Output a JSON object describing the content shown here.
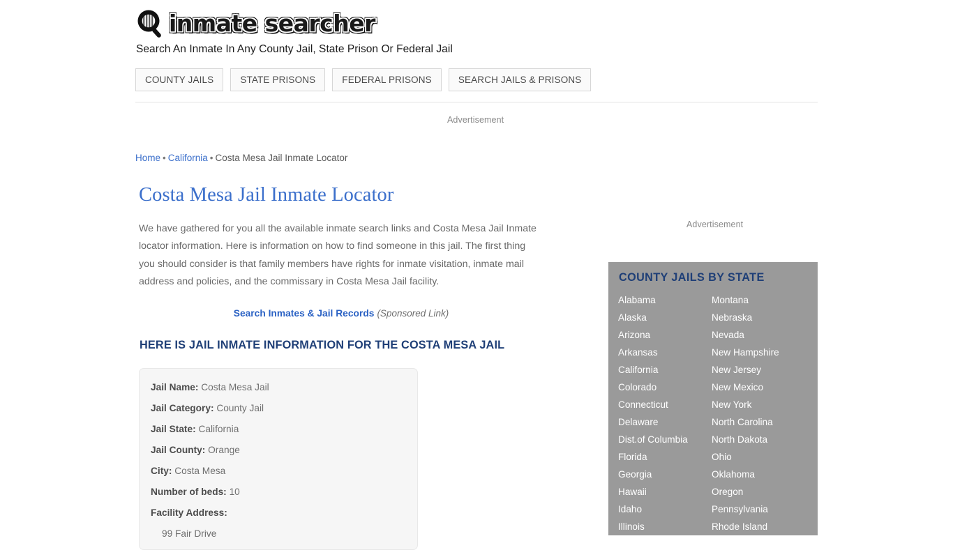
{
  "header": {
    "logo_icon": "magnifier-jail-bars-icon",
    "logo_text": "inmate searcher",
    "tagline": "Search An Inmate In Any County Jail, State Prison Or Federal Jail"
  },
  "nav": {
    "items": [
      {
        "label": "COUNTY JAILS"
      },
      {
        "label": "STATE PRISONS"
      },
      {
        "label": "FEDERAL PRISONS"
      },
      {
        "label": "SEARCH JAILS & PRISONS"
      }
    ]
  },
  "ads": {
    "top_label": "Advertisement",
    "side_label": "Advertisement"
  },
  "breadcrumb": {
    "home": "Home",
    "sep1": "•",
    "state": "California",
    "sep2": "•",
    "current": "Costa Mesa Jail Inmate Locator"
  },
  "main": {
    "title": "Costa Mesa Jail Inmate Locator",
    "intro": "We have gathered for you all the available inmate search links and Costa Mesa Jail Inmate locator information. Here is information on how to find someone in this jail. The first thing you should consider is that family members have rights for inmate visitation, inmate mail address and policies, and the commissary in Costa Mesa Jail facility.",
    "sponsored_link_text": "Search Inmates & Jail Records",
    "sponsored_note": "(Sponsored Link)",
    "section_heading": "HERE IS JAIL INMATE INFORMATION FOR THE COSTA MESA JAIL",
    "info": {
      "rows": [
        {
          "label": "Jail Name:",
          "value": "Costa Mesa Jail"
        },
        {
          "label": "Jail Category:",
          "value": "County Jail"
        },
        {
          "label": "Jail State:",
          "value": "California"
        },
        {
          "label": "Jail County:",
          "value": "Orange"
        },
        {
          "label": "City:",
          "value": "Costa Mesa"
        },
        {
          "label": "Number of beds:",
          "value": "10"
        }
      ],
      "address_label": "Facility Address:",
      "address_line1": "99 Fair Drive"
    }
  },
  "sidebar": {
    "title": "COUNTY JAILS BY STATE",
    "background_color": "#9a9a9a",
    "title_color": "#1f3f77",
    "link_color": "#ffffff",
    "column_left": [
      "Alabama",
      "Alaska",
      "Arizona",
      "Arkansas",
      "California",
      "Colorado",
      "Connecticut",
      "Delaware",
      "Dist.of Columbia",
      "Florida",
      "Georgia",
      "Hawaii",
      "Idaho",
      "Illinois"
    ],
    "column_right": [
      "Montana",
      "Nebraska",
      "Nevada",
      "New Hampshire",
      "New Jersey",
      "New Mexico",
      "New York",
      "North Carolina",
      "North Dakota",
      "Ohio",
      "Oklahoma",
      "Oregon",
      "Pennsylvania",
      "Rhode Island"
    ]
  },
  "colors": {
    "link_blue": "#3b6fcb",
    "heading_navy": "#1f3f77",
    "body_gray": "#6a6a6a",
    "sidebar_gray": "#9a9a9a"
  }
}
